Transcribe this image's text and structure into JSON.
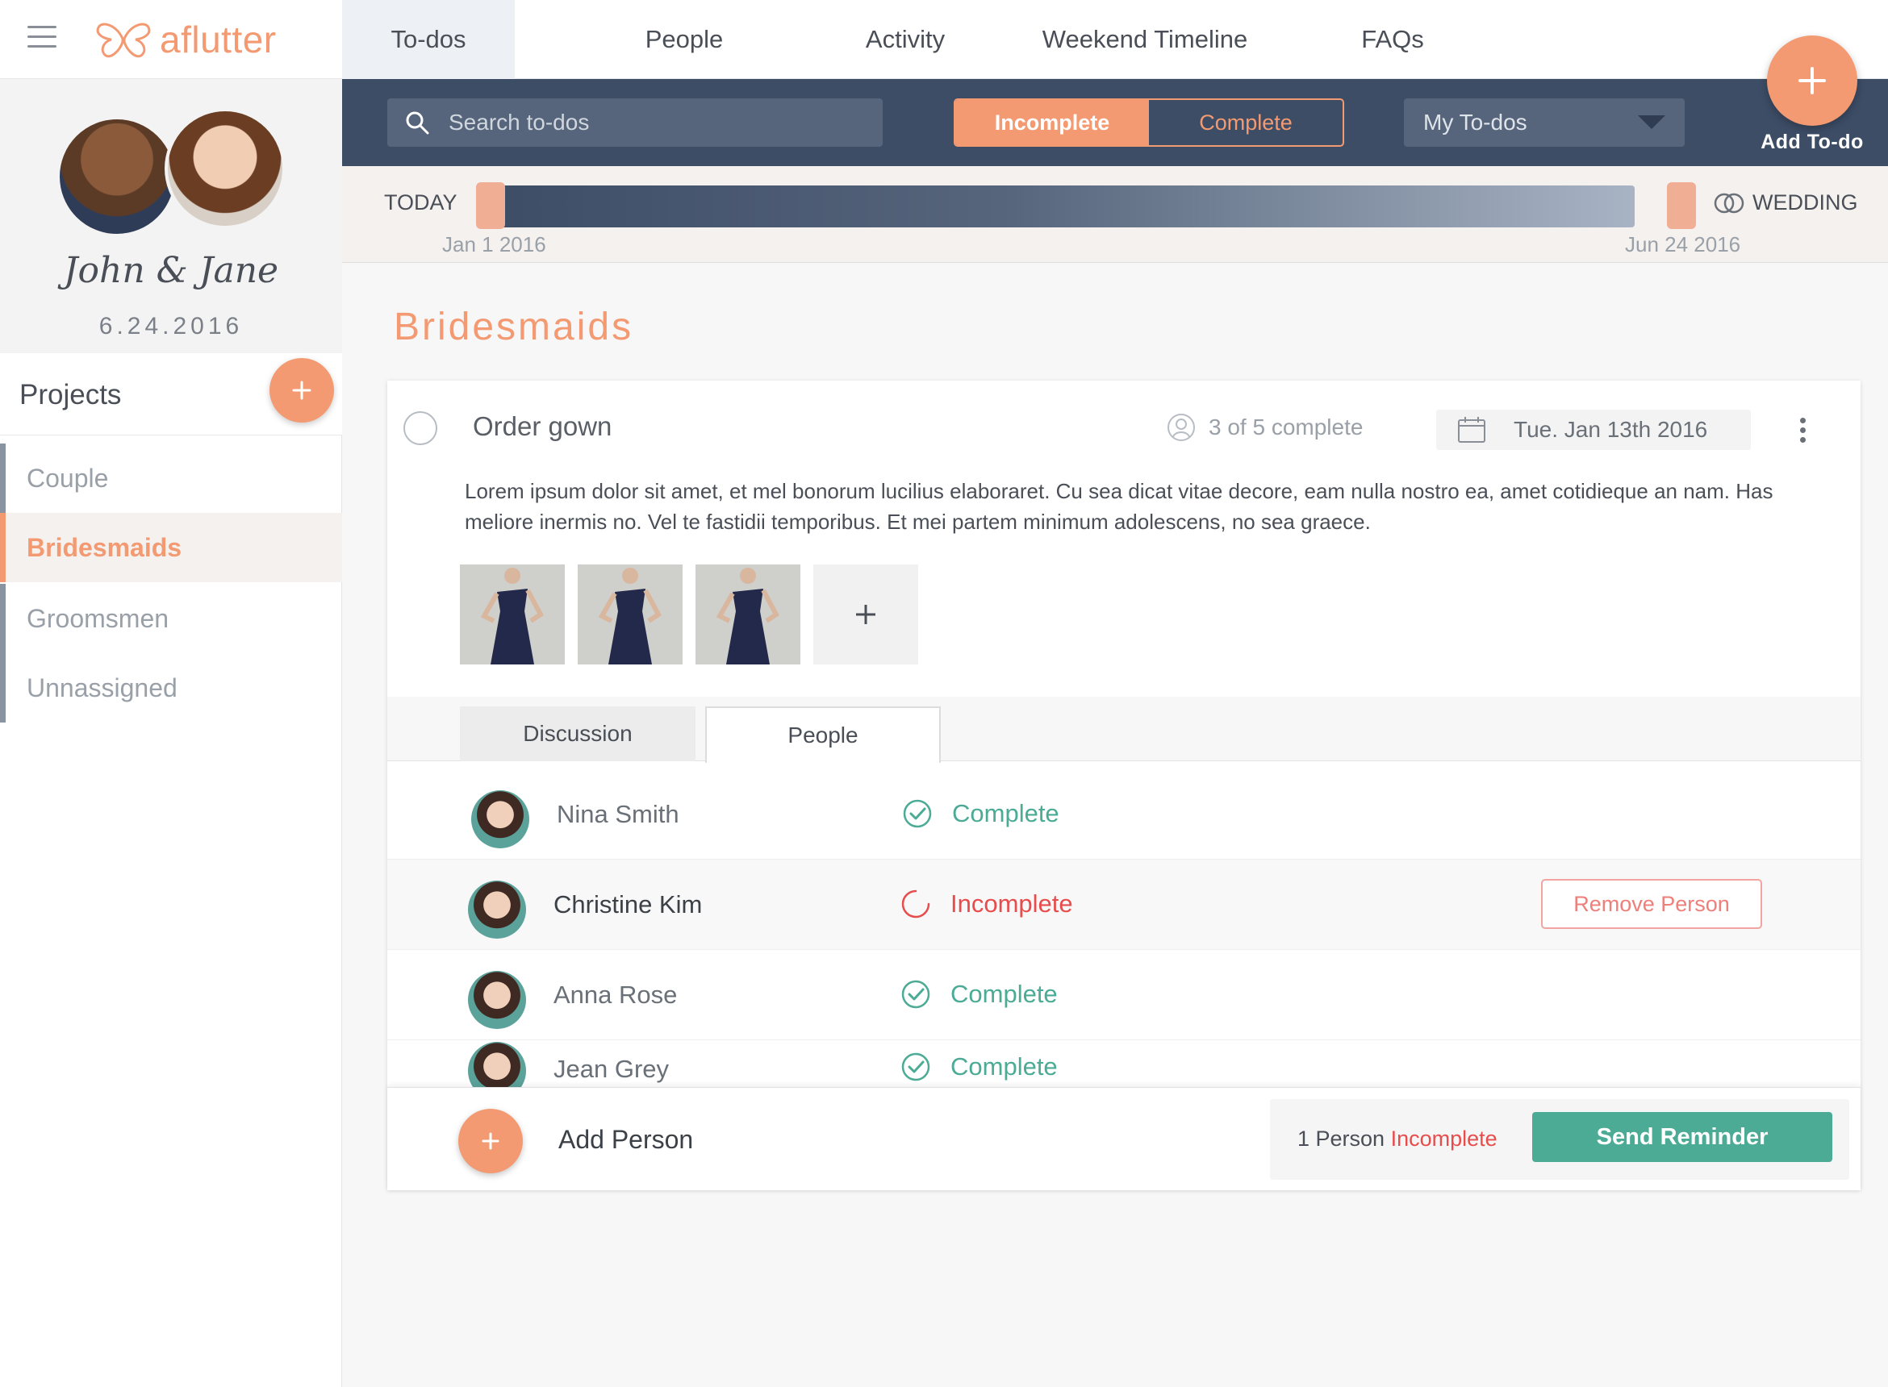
{
  "app": {
    "logo_text": "aflutter"
  },
  "nav": {
    "tabs": [
      {
        "label": "To-dos",
        "active": true
      },
      {
        "label": "People"
      },
      {
        "label": "Activity"
      },
      {
        "label": "Weekend Timeline"
      },
      {
        "label": "FAQs"
      }
    ]
  },
  "toolbar": {
    "search_placeholder": "Search to-dos",
    "segment_incomplete": "Incomplete",
    "segment_complete": "Complete",
    "filter_selected": "My To-dos",
    "add_todo_label": "Add To-do"
  },
  "timeline": {
    "start_label": "TODAY",
    "end_label": "WEDDING",
    "start_date": "Jan 1 2016",
    "end_date": "Jun 24 2016"
  },
  "sidebar": {
    "couple_name": "John & Jane",
    "wedding_date": "6.24.2016",
    "projects_title": "Projects",
    "projects": [
      {
        "label": "Couple"
      },
      {
        "label": "Bridesmaids",
        "active": true
      },
      {
        "label": "Groomsmen"
      },
      {
        "label": "Unnassigned"
      }
    ]
  },
  "main": {
    "section_title": "Bridesmaids",
    "todo": {
      "title": "Order gown",
      "progress_text": "3 of 5 complete",
      "due_date": "Tue. Jan 13th 2016",
      "description": "Lorem ipsum dolor sit amet, et mel bonorum lucilius elaboraret. Cu sea dicat vitae decore, eam nulla nostro ea, amet cotidieque an nam. Has meliore inermis no. Vel te fastidii temporibus. Et mei partem minimum adolescens, no sea graece.",
      "tabs": {
        "discussion": "Discussion",
        "people": "People"
      },
      "people": [
        {
          "name": "Nina Smith",
          "status": "Complete"
        },
        {
          "name": "Christine Kim",
          "status": "Incomplete",
          "action": "Remove Person"
        },
        {
          "name": "Anna Rose",
          "status": "Complete"
        },
        {
          "name": "Jean Grey",
          "status": "Complete"
        }
      ],
      "footer": {
        "add_person_label": "Add Person",
        "reminder_prefix": "1 Person",
        "reminder_flag": "Incomplete",
        "send_reminder_label": "Send Reminder"
      }
    }
  },
  "colors": {
    "accent": "#f39a72",
    "navy": "#3d4d66",
    "success": "#4bab95",
    "danger": "#e84d4d"
  },
  "icons": [
    "hamburger-icon",
    "butterfly-logo-icon",
    "search-icon",
    "chevron-down-icon",
    "plus-icon",
    "rings-icon",
    "person-icon",
    "calendar-icon",
    "more-vertical-icon",
    "check-circle-icon",
    "spinner-icon"
  ]
}
